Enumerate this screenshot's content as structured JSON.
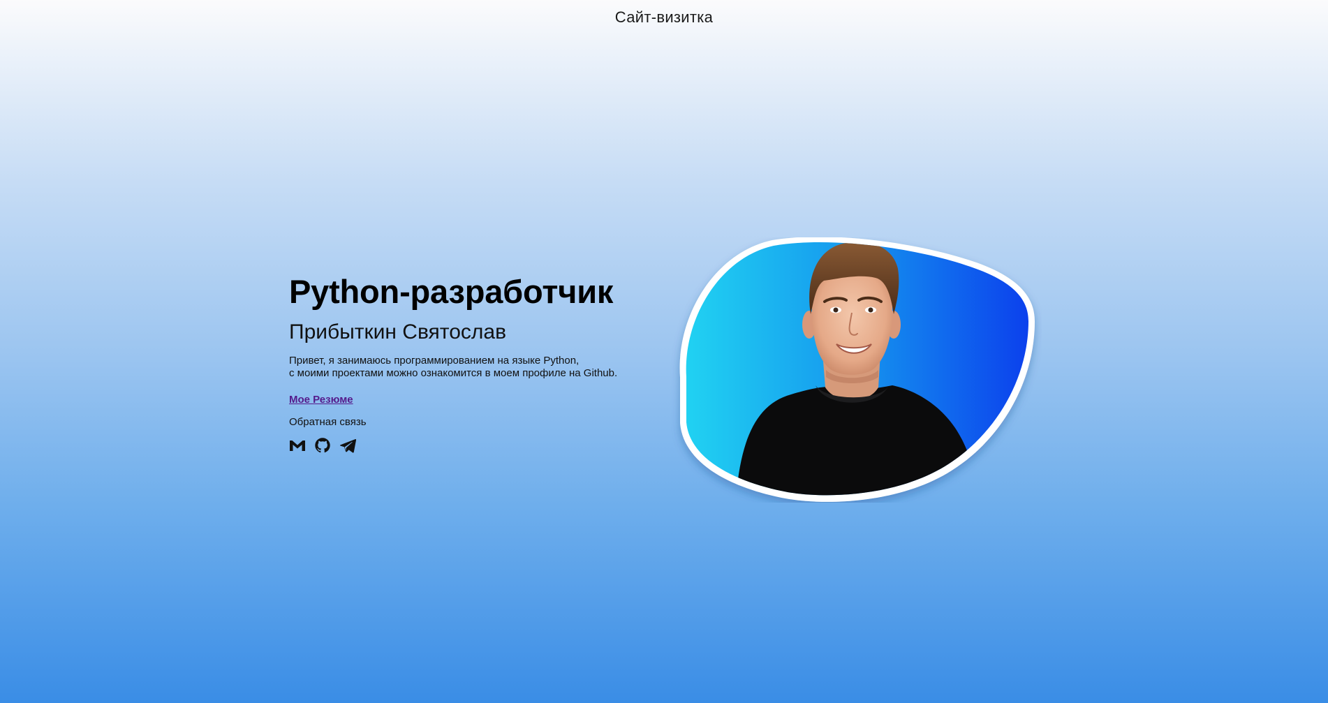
{
  "header": {
    "site_title": "Сайт-визитка"
  },
  "hero": {
    "headline": "Python-разработчик",
    "name": "Прибыткин Святослав",
    "bio_line_1": "Привет, я занимаюсь программированием на языке Python,",
    "bio_line_2": "с моими проектами можно ознакомится в моем профиле на Github.",
    "resume_link": "Мое Резюме",
    "feedback_label": "Обратная связь"
  },
  "socials": [
    {
      "icon": "gmail-icon"
    },
    {
      "icon": "github-icon"
    },
    {
      "icon": "telegram-icon"
    }
  ],
  "photo": {
    "subject": "portrait-photo"
  },
  "colors": {
    "background_top": "#fbfbfc",
    "background_bottom": "#3a8de6",
    "link": "#551a8b",
    "photo_gradient_left": "#22d8f2",
    "photo_gradient_right": "#0b3aed"
  }
}
